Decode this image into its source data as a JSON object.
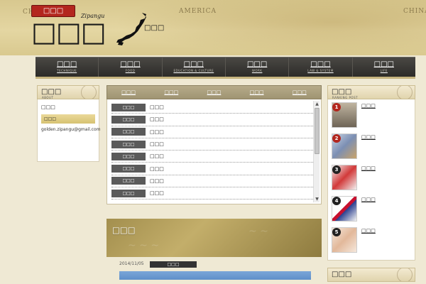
{
  "header": {
    "logo_badge": "□□□",
    "logo_main": "□□□",
    "logo_latin": "Zipangu",
    "tagline": "□□□",
    "place_labels": [
      "AMERICA",
      "CHINA",
      "CH"
    ]
  },
  "nav": {
    "items": [
      {
        "jp": "□□□",
        "en": "TECHNIQUE"
      },
      {
        "jp": "□□□",
        "en": "FOOD"
      },
      {
        "jp": "□□□",
        "en": "EDUCATION & CULTURE"
      },
      {
        "jp": "□□□",
        "en": "WORK"
      },
      {
        "jp": "□□□",
        "en": "LAW & SYSTEM"
      },
      {
        "jp": "□□□",
        "en": "LIFE"
      }
    ]
  },
  "about": {
    "title": "□□□",
    "subtitle": "ABOUT",
    "body": "□□□",
    "contact_label": "□□□",
    "email": "golden.zipangu@gmail.com"
  },
  "tabs": [
    "□□□",
    "□□□",
    "□□□",
    "□□□",
    "□□□"
  ],
  "news": [
    {
      "badge": "□□□",
      "title": "□□□"
    },
    {
      "badge": "□□□",
      "title": "□□□"
    },
    {
      "badge": "□□□",
      "title": "□□□"
    },
    {
      "badge": "□□□",
      "title": "□□□"
    },
    {
      "badge": "□□□",
      "title": "□□□"
    },
    {
      "badge": "□□□",
      "title": "□□□"
    },
    {
      "badge": "□□□",
      "title": "□□□"
    },
    {
      "badge": "□□□",
      "title": "□□□"
    }
  ],
  "article": {
    "title": "□□□",
    "date": "2014/11/05",
    "category": "□□□"
  },
  "popular": {
    "title": "□□□",
    "subtitle": "RANKING POST",
    "items": [
      {
        "rank": "1",
        "title": "□□□",
        "rank_color": "#b3261e"
      },
      {
        "rank": "2",
        "title": "□□□",
        "rank_color": "#b3261e"
      },
      {
        "rank": "3",
        "title": "□□□",
        "rank_color": "#222222"
      },
      {
        "rank": "4",
        "title": "□□□",
        "rank_color": "#222222"
      },
      {
        "rank": "5",
        "title": "□□□",
        "rank_color": "#222222"
      }
    ]
  },
  "category": {
    "title": "□□□"
  }
}
